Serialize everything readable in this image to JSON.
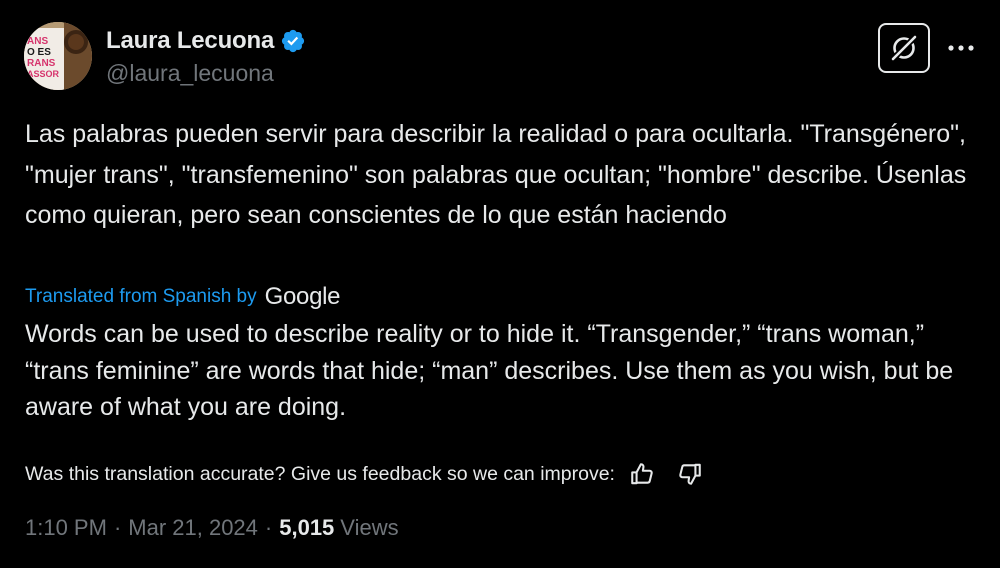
{
  "author": {
    "display_name": "Laura Lecuona",
    "handle": "@laura_lecuona",
    "verified": true,
    "avatar_book_text": [
      "ANS",
      "O ES",
      "RANS",
      "ASSOR"
    ]
  },
  "tweet": {
    "text": "Las palabras pueden servir para describir la realidad o para ocultarla. \"Transgénero\", \"mujer trans\", \"transfemenino\" son palabras que ocultan; \"hombre\" describe. Úsenlas como quieran, pero sean conscientes de lo que están haciendo"
  },
  "translation": {
    "label": "Translated from Spanish by",
    "provider": "Google",
    "text": "Words can be used to describe reality or to hide it. “Transgender,” “trans woman,” “trans feminine” are words that hide; “man” describes. Use them as you wish, but be aware of what you are doing.",
    "feedback_prompt": "Was this translation accurate? Give us feedback so we can improve:"
  },
  "meta": {
    "time": "1:10 PM",
    "date": "Mar 21, 2024",
    "views_count": "5,015",
    "views_label": "Views",
    "separator": "·"
  },
  "icons": {
    "verified": "verified-badge-icon",
    "grok": "grok-icon",
    "more": "more-icon",
    "thumbs_up": "thumbs-up-icon",
    "thumbs_down": "thumbs-down-icon"
  },
  "colors": {
    "background": "#000000",
    "text": "#e7e9ea",
    "secondary": "#71767b",
    "accent": "#1d9bf0"
  }
}
